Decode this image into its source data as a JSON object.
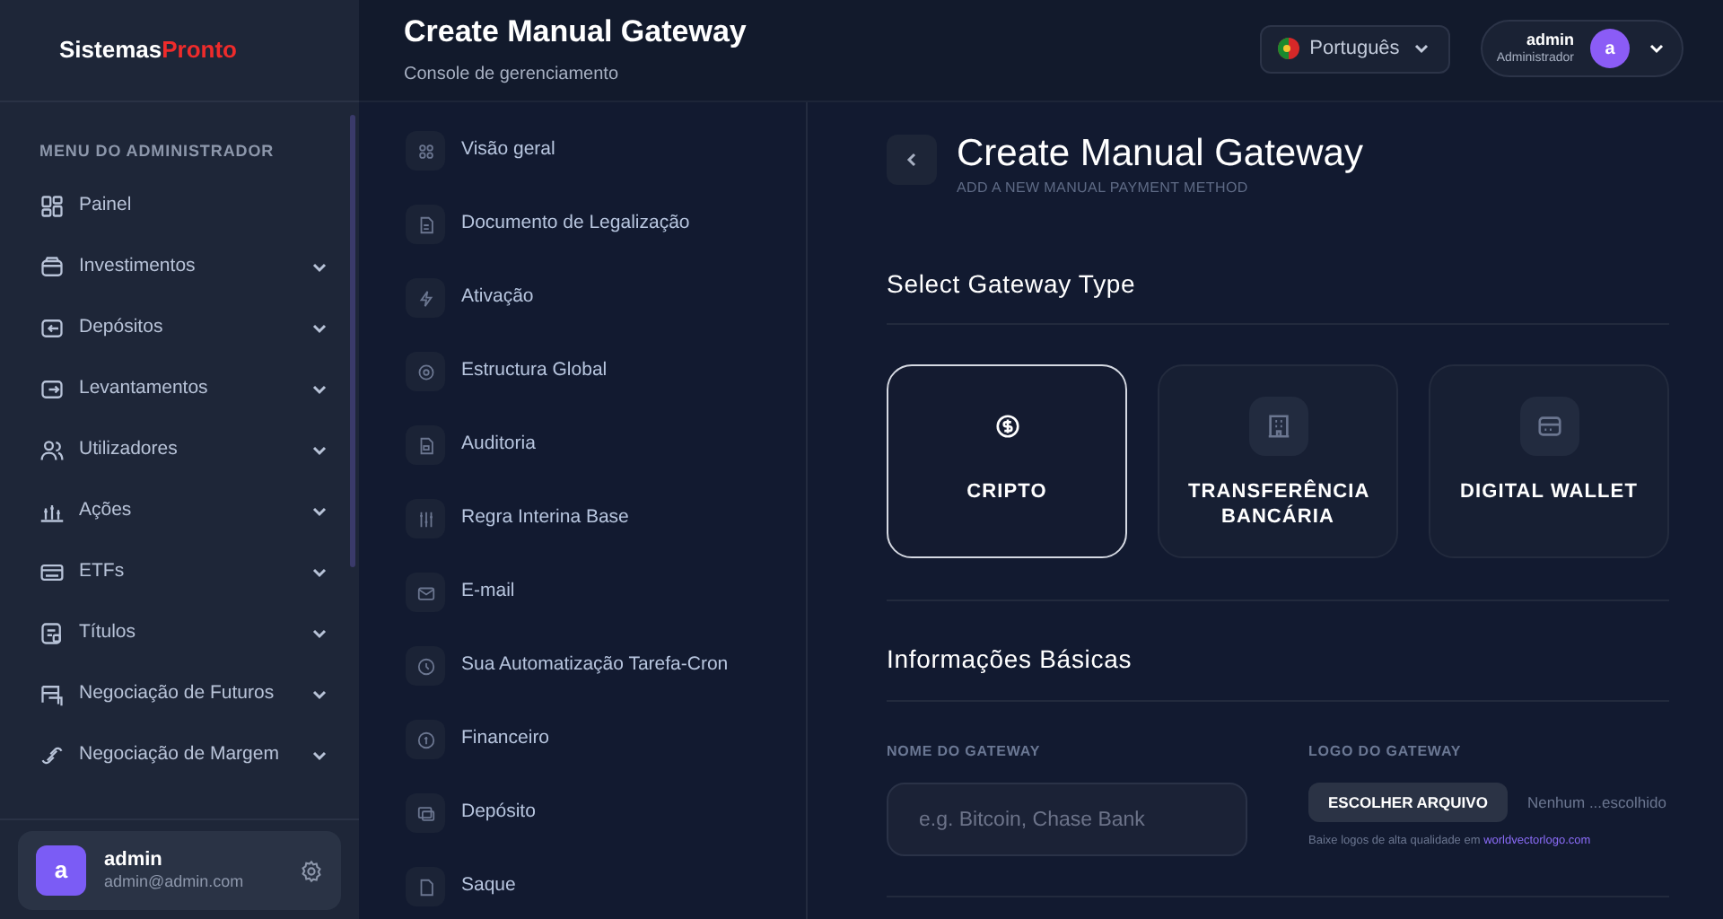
{
  "brand": {
    "first": "Sistemas",
    "second": "Pronto"
  },
  "sidebar": {
    "heading": "MENU DO ADMINISTRADOR",
    "items": [
      {
        "label": "Painel",
        "expandable": false
      },
      {
        "label": "Investimentos",
        "expandable": true
      },
      {
        "label": "Depósitos",
        "expandable": true
      },
      {
        "label": "Levantamentos",
        "expandable": true
      },
      {
        "label": "Utilizadores",
        "expandable": true
      },
      {
        "label": "Ações",
        "expandable": true
      },
      {
        "label": "ETFs",
        "expandable": true
      },
      {
        "label": "Títulos",
        "expandable": true
      },
      {
        "label": "Negociação de Futuros",
        "expandable": true
      },
      {
        "label": "Negociação de Margem",
        "expandable": true
      }
    ],
    "user": {
      "avatar": "a",
      "name": "admin",
      "email": "admin@admin.com"
    }
  },
  "header": {
    "title": "Create Manual Gateway",
    "subtitle": "Console de gerenciamento",
    "language": "Português",
    "user": {
      "name": "admin",
      "role": "Administrador",
      "avatar": "a"
    }
  },
  "settings_menu": [
    {
      "label": "Visão geral"
    },
    {
      "label": "Documento de Legalização"
    },
    {
      "label": "Ativação"
    },
    {
      "label": "Estructura Global"
    },
    {
      "label": "Auditoria"
    },
    {
      "label": "Regra Interina Base"
    },
    {
      "label": "E-mail"
    },
    {
      "label": "Sua Automatização Tarefa-Cron"
    },
    {
      "label": "Financeiro"
    },
    {
      "label": "Depósito"
    },
    {
      "label": "Saque"
    }
  ],
  "page": {
    "title": "Create Manual Gateway",
    "subtitle": "ADD A NEW MANUAL PAYMENT METHOD",
    "type_section": "Select Gateway Type",
    "gateway_types": [
      {
        "label": "CRIPTO",
        "selected": true
      },
      {
        "label": "TRANSFERÊNCIA BANCÁRIA",
        "selected": false
      },
      {
        "label": "DIGITAL WALLET",
        "selected": false
      }
    ],
    "basic_section": "Informações Básicas",
    "name_field": {
      "label": "NOME DO GATEWAY",
      "placeholder": "e.g. Bitcoin, Chase Bank"
    },
    "logo_field": {
      "label": "LOGO DO GATEWAY",
      "button": "ESCOLHER ARQUIVO",
      "file_status": "Nenhum ...escolhido",
      "hint": "Baixe logos de alta qualidade em",
      "hint_link": "worldvectorlogo.com"
    }
  }
}
